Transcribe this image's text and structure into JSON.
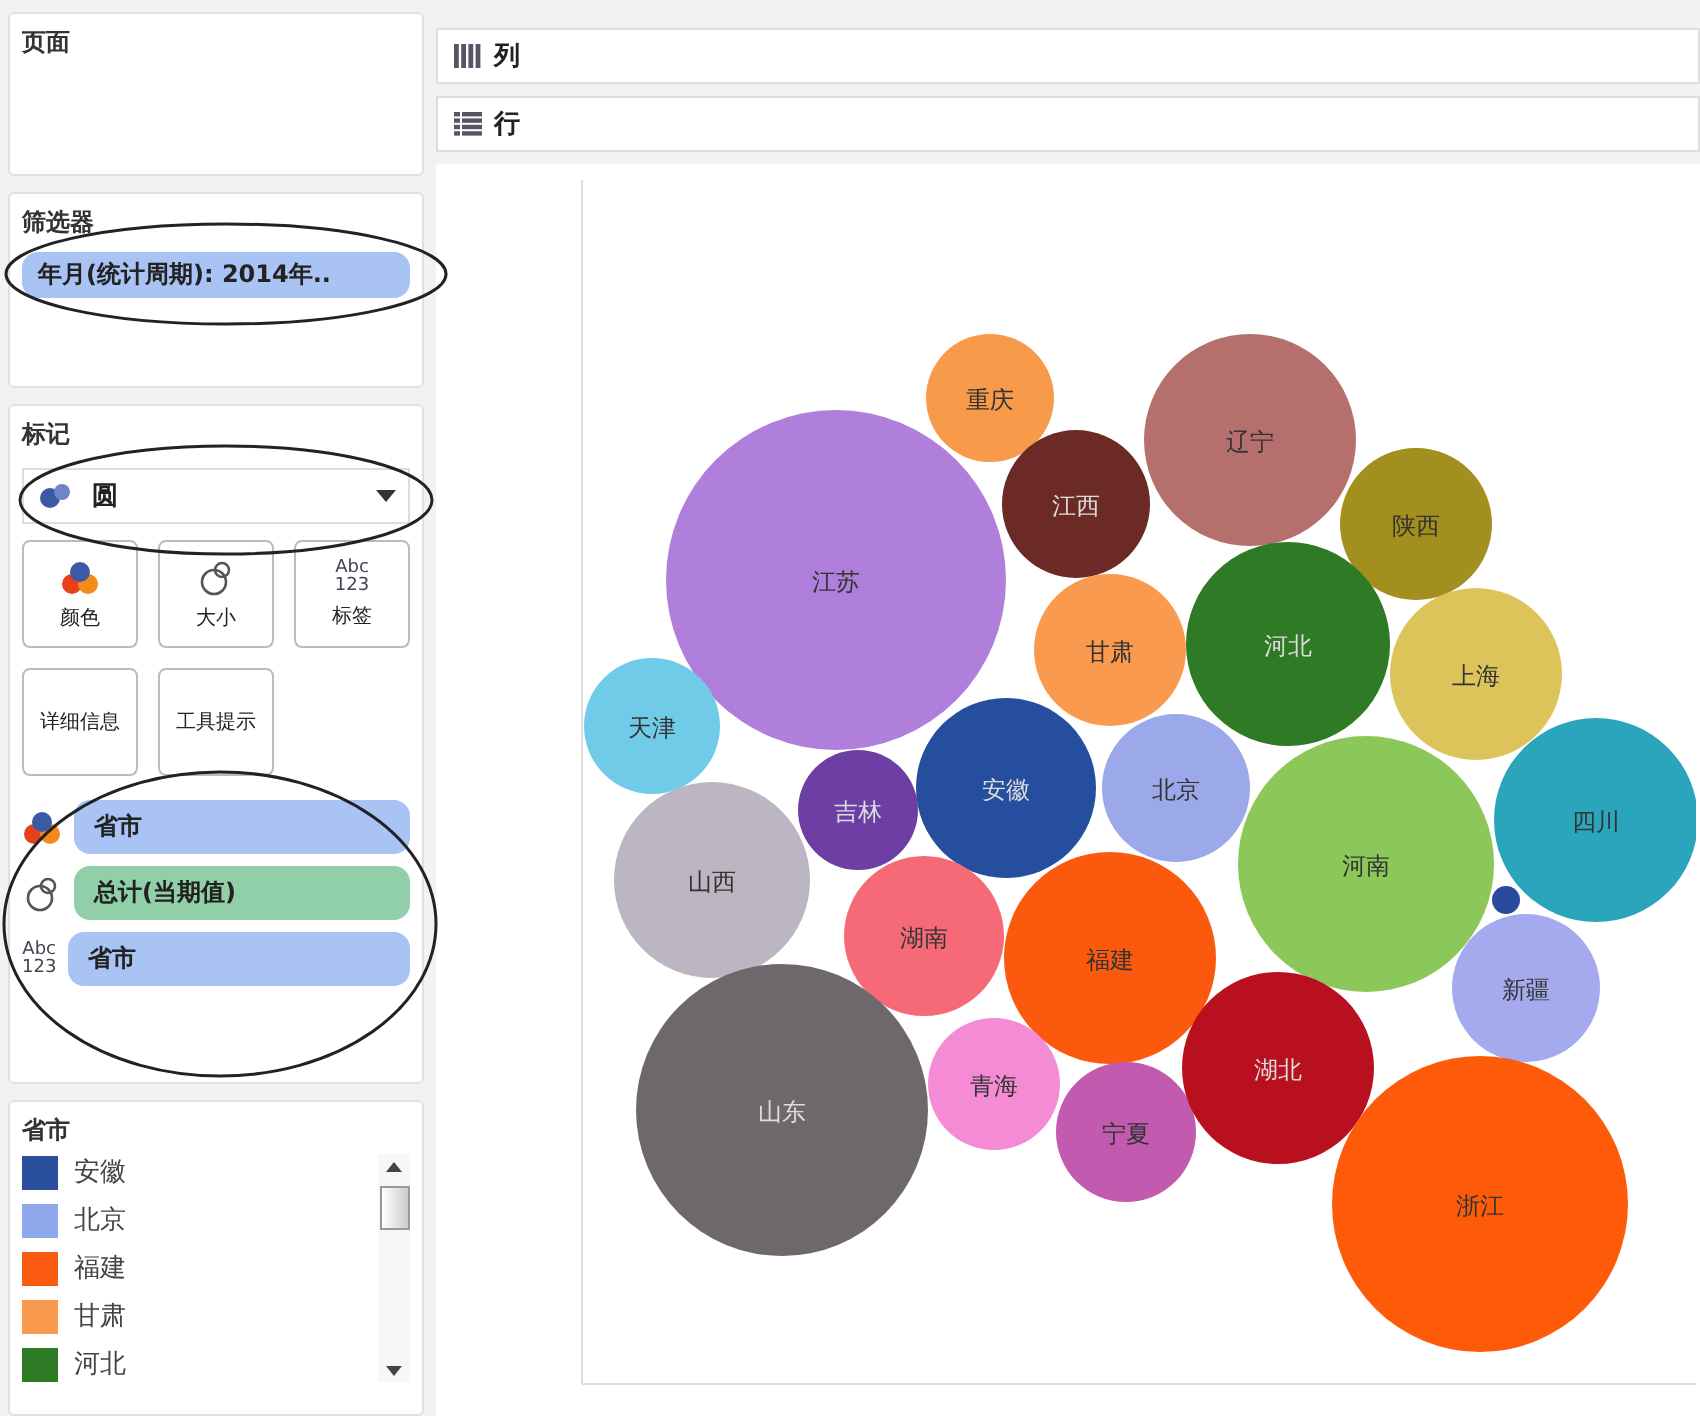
{
  "pages_card": {
    "title": "页面"
  },
  "filters_card": {
    "title": "筛选器",
    "pills": [
      {
        "label": "年月(统计周期): 2014年.."
      }
    ]
  },
  "marks_card": {
    "title": "标记",
    "mark_type": "圆",
    "buttons": [
      {
        "label": "颜色",
        "kind": "color"
      },
      {
        "label": "大小",
        "kind": "size"
      },
      {
        "label": "标签",
        "kind": "label",
        "icon_text": "Abc\n123"
      },
      {
        "label": "详细信息",
        "kind": "detail"
      },
      {
        "label": "工具提示",
        "kind": "tooltip"
      }
    ],
    "fields": [
      {
        "label": "省市",
        "kind": "color",
        "measure": false
      },
      {
        "label": "总计(当期值)",
        "kind": "size",
        "measure": true
      },
      {
        "label": "省市",
        "kind": "label",
        "measure": false,
        "icon_text": "Abc\n123"
      }
    ]
  },
  "legend": {
    "title": "省市",
    "items": [
      {
        "label": "安徽",
        "color": "#2a4f9c"
      },
      {
        "label": "北京",
        "color": "#8fa9ea"
      },
      {
        "label": "福建",
        "color": "#fb5a12"
      },
      {
        "label": "甘肃",
        "color": "#f99a4e"
      },
      {
        "label": "河北",
        "color": "#2f7a25"
      }
    ]
  },
  "shelves": [
    {
      "label": "列",
      "kind": "columns"
    },
    {
      "label": "行",
      "kind": "rows"
    }
  ],
  "bubbles": [
    {
      "label": "重庆",
      "color": "#f79a4a"
    },
    {
      "label": "辽宁",
      "color": "#b5706e"
    },
    {
      "label": "江西",
      "color": "#6b2a25"
    },
    {
      "label": "陕西",
      "color": "#a38f1e"
    },
    {
      "label": "江苏",
      "color": "#b07fdc"
    },
    {
      "label": "甘肃",
      "color": "#f99a4e"
    },
    {
      "label": "河北",
      "color": "#2f7a25"
    },
    {
      "label": "上海",
      "color": "#ddc45a"
    },
    {
      "label": "天津",
      "color": "#6fcbe8"
    },
    {
      "label": "吉林",
      "color": "#6d3ea3"
    },
    {
      "label": "安徽",
      "color": "#254e9e"
    },
    {
      "label": "北京",
      "color": "#9ba8ea"
    },
    {
      "label": "河南",
      "color": "#8cc75a"
    },
    {
      "label": "四川",
      "color": "#2aa5bb"
    },
    {
      "label": "山西",
      "color": "#bcb5c2"
    },
    {
      "label": "湖南",
      "color": "#f66a78"
    },
    {
      "label": "福建",
      "color": "#fb5a0e"
    },
    {
      "color": "#2a4a9e"
    },
    {
      "label": "新疆",
      "color": "#a5aaee"
    },
    {
      "label": "山东",
      "color": "#6e686c"
    },
    {
      "label": "青海",
      "color": "#f48bd4"
    },
    {
      "label": "宁夏",
      "color": "#c25ab0"
    },
    {
      "label": "湖北",
      "color": "#b8101e"
    },
    {
      "label": "浙江",
      "color": "#fd5a0a"
    }
  ]
}
